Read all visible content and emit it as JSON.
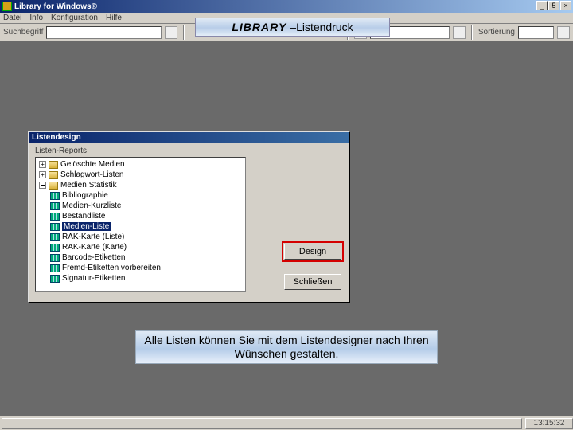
{
  "titlebar": {
    "title": "Library for Windows®",
    "minimize": "_",
    "restore": "5",
    "close": "×"
  },
  "menu": [
    "Datei",
    "Info",
    "Konfiguration",
    "Hilfe"
  ],
  "toolbar": {
    "search_label": "Suchbegriff",
    "right_label": "",
    "sort_label": "Sortierung"
  },
  "banner": {
    "brand": "LIBRARY",
    "sep": " – ",
    "title": "Listendruck"
  },
  "dialog": {
    "title": "Listendesign",
    "group": "Listen-Reports",
    "tree": {
      "root": {
        "a": "Gelöschte Medien",
        "b": "Schlagwort-Listen",
        "c": "Medien Statistik",
        "children": [
          "Bibliographie",
          "Medien-Kurzliste",
          "Bestandliste",
          "Medien-Liste",
          "RAK-Karte (Liste)",
          "RAK-Karte (Karte)",
          "Barcode-Etiketten",
          "Fremd-Etiketten vorbereiten",
          "Signatur-Etiketten"
        ]
      }
    },
    "selected": "Medien-Liste",
    "design_btn": "Design",
    "close_btn": "Schließen"
  },
  "caption": "Alle Listen können Sie mit dem Listendesigner nach Ihren Wünschen gestalten.",
  "status": {
    "time": "13:15:32"
  }
}
